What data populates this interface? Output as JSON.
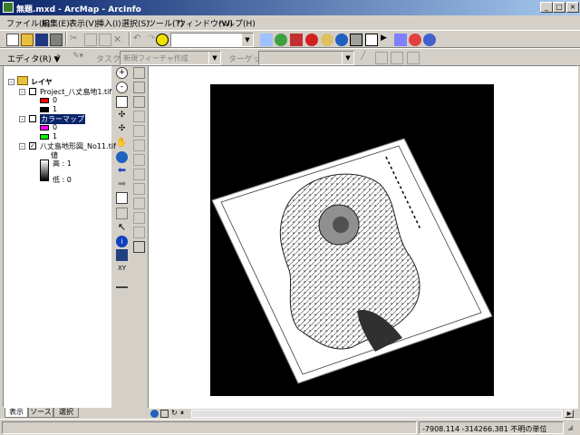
{
  "window": {
    "title": "無題.mxd - ArcMap - ArcInfo"
  },
  "menu": [
    "ファイル(F)",
    "編集(E)",
    "表示(V)",
    "挿入(I)",
    "選択(S)",
    "ツール(T)",
    "ウィンドウ(W)",
    "ヘルプ(H)"
  ],
  "editor": {
    "label": "エディタ(R) ▼",
    "task_label": "タスク:",
    "task_value": "新規フィーチャ作成",
    "target_label": "ターゲット:"
  },
  "toc": {
    "root": "レイヤ",
    "layers": [
      {
        "name": "Project_八丈島地1.tif",
        "checked": false,
        "legend": [
          {
            "label": "0",
            "color": "#ff0000"
          },
          {
            "label": "1",
            "color": "#000000"
          }
        ]
      },
      {
        "name": "カラーマップ",
        "checked": false,
        "selected": true,
        "legend": [
          {
            "label": "0",
            "color": "#ff00ff"
          },
          {
            "label": "1",
            "color": "#00ff00"
          }
        ]
      },
      {
        "name": "八丈島地形図_No11.tif",
        "checked": true,
        "legend_title": "値",
        "high": "高 : 1",
        "low": "低 : 0"
      }
    ],
    "tabs": [
      "表示",
      "ソース",
      "選択"
    ]
  },
  "status": {
    "coords": "-7908.114  -314266.381 不明の単位"
  },
  "colors": {
    "titlebar_start": "#0a246a",
    "titlebar_end": "#a6caf0",
    "selection": "#0a246a",
    "chrome": "#d4d0c8"
  }
}
